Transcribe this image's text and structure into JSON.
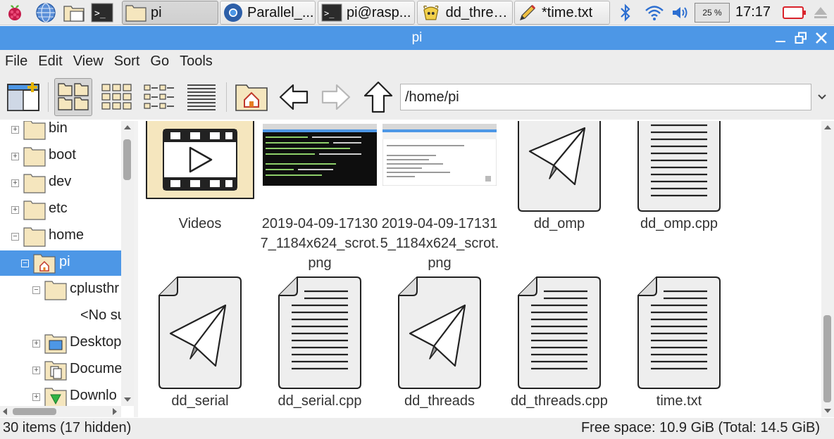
{
  "taskbar": {
    "tasks": [
      {
        "label": "pi",
        "icon": "folder-icon",
        "active": true
      },
      {
        "label": "Parallel_...",
        "icon": "chromium-icon"
      },
      {
        "label": "pi@rasp...",
        "icon": "terminal-icon"
      },
      {
        "label": "dd_threa...",
        "icon": "geany-icon"
      },
      {
        "label": "*time.txt",
        "icon": "text-editor-icon"
      }
    ],
    "cpu_usage": "25 %",
    "clock": "17:17"
  },
  "window": {
    "title": "pi"
  },
  "menu": [
    "File",
    "Edit",
    "View",
    "Sort",
    "Go",
    "Tools"
  ],
  "toolbar": {
    "path": "/home/pi"
  },
  "tree": [
    {
      "label": "bin",
      "expander": "+"
    },
    {
      "label": "boot",
      "expander": "+"
    },
    {
      "label": "dev",
      "expander": "+"
    },
    {
      "label": "etc",
      "expander": "+"
    },
    {
      "label": "home",
      "expander": "−"
    },
    {
      "label": "pi",
      "expander": "−",
      "selected": true
    },
    {
      "label": "cplusthr",
      "expander": "−"
    },
    {
      "label": "<No su"
    },
    {
      "label": "Desktop",
      "expander": "+"
    },
    {
      "label": "Docume",
      "expander": "+"
    },
    {
      "label": "Downlo",
      "expander": "+"
    }
  ],
  "files": [
    {
      "name": "Videos",
      "icon": "videos-folder-icon"
    },
    {
      "name": "2019-04-09-171307_1184x624_scrot.png",
      "icon": "screenshot-thumbnail"
    },
    {
      "name": "2019-04-09-171315_1184x624_scrot.png",
      "icon": "screenshot-thumbnail"
    },
    {
      "name": "dd_omp",
      "icon": "executable-icon"
    },
    {
      "name": "dd_omp.cpp",
      "icon": "text-file-icon"
    },
    {
      "name": "dd_serial",
      "icon": "executable-icon"
    },
    {
      "name": "dd_serial.cpp",
      "icon": "text-file-icon"
    },
    {
      "name": "dd_threads",
      "icon": "executable-icon"
    },
    {
      "name": "dd_threads.cpp",
      "icon": "text-file-icon"
    },
    {
      "name": "time.txt",
      "icon": "text-file-icon"
    }
  ],
  "status": {
    "items": "30 items (17 hidden)",
    "free": "Free space: 10.9 GiB (Total: 14.5 GiB)"
  },
  "colors": {
    "accent": "#4d97e6",
    "folder": "#f5e6be"
  }
}
